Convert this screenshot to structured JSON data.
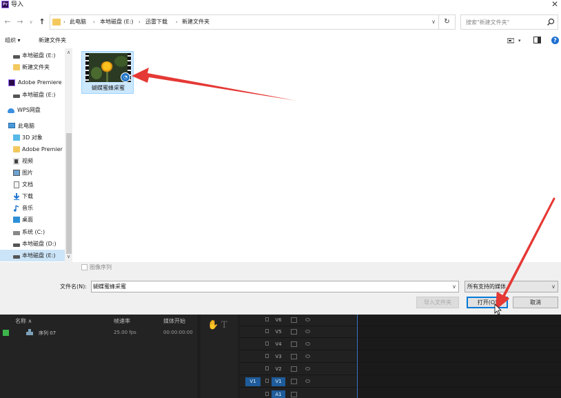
{
  "window": {
    "title": "导入",
    "app_badge": "Pr",
    "close": "✕"
  },
  "address_bar": {
    "back": "←",
    "forward": "→",
    "recent": "∨",
    "up": "↑",
    "breadcrumbs": [
      "此电脑",
      "本地磁盘 (E:)",
      "迅雷下载",
      "新建文件夹"
    ],
    "dropdown": "∨",
    "refresh": "↻",
    "search_placeholder": "搜索\"新建文件夹\""
  },
  "toolbar": {
    "organize": "组织 ▾",
    "new_folder": "新建文件夹",
    "help": "?"
  },
  "nav_pane": {
    "items": [
      {
        "label": "本地磁盘 (E:)",
        "icon": "drive-icon"
      },
      {
        "label": "新建文件夹",
        "icon": "folder-icon"
      },
      {
        "label": "Adobe Premiere",
        "icon": "premiere-icon"
      },
      {
        "label": "本地磁盘 (E:)",
        "icon": "drive-icon"
      },
      {
        "label": "WPS网盘",
        "icon": "cloud-icon"
      },
      {
        "label": "此电脑",
        "icon": "computer-icon"
      },
      {
        "label": "3D 对象",
        "icon": "3d-objects-icon"
      },
      {
        "label": "Adobe Premier",
        "icon": "folder-icon"
      },
      {
        "label": "视频",
        "icon": "video-icon"
      },
      {
        "label": "图片",
        "icon": "pictures-icon"
      },
      {
        "label": "文档",
        "icon": "documents-icon"
      },
      {
        "label": "下载",
        "icon": "download-icon"
      },
      {
        "label": "音乐",
        "icon": "music-icon"
      },
      {
        "label": "桌面",
        "icon": "desktop-icon"
      },
      {
        "label": "系统 (C:)",
        "icon": "system-drive-icon"
      },
      {
        "label": "本地磁盘 (D:)",
        "icon": "drive-icon"
      },
      {
        "label": "本地磁盘 (E:)",
        "icon": "drive-icon",
        "selected": true
      }
    ]
  },
  "files": [
    {
      "name": "蝴蝶蜜蜂采蜜",
      "icon": "video-file-icon"
    }
  ],
  "dialog": {
    "image_sequence_label": "图像序列",
    "filename_label": "文件名(N):",
    "filename_value": "蝴蝶蜜蜂采蜜",
    "filetype_value": "所有支持的媒体",
    "import_folder_button": "导入文件夹",
    "open_button": "打开(O)",
    "cancel_button": "取消"
  },
  "premiere": {
    "project_headers": {
      "name": "名称 ∧",
      "frame_rate": "帧速率",
      "media_start": "媒体开始"
    },
    "project_rows": [
      {
        "name": "序列 07",
        "frame_rate": "25.00 fps",
        "media_start": "00:00:00:00",
        "swatch_color": "#3cb54a"
      }
    ],
    "tracks": [
      "V6",
      "V5",
      "V4",
      "V3",
      "V2",
      "V1",
      "A1"
    ],
    "source_track": "V1",
    "tools": [
      "✋",
      "T"
    ]
  },
  "colors": {
    "accent": "#0078d7",
    "selection": "#cce4f7",
    "annotation": "#e53935"
  }
}
